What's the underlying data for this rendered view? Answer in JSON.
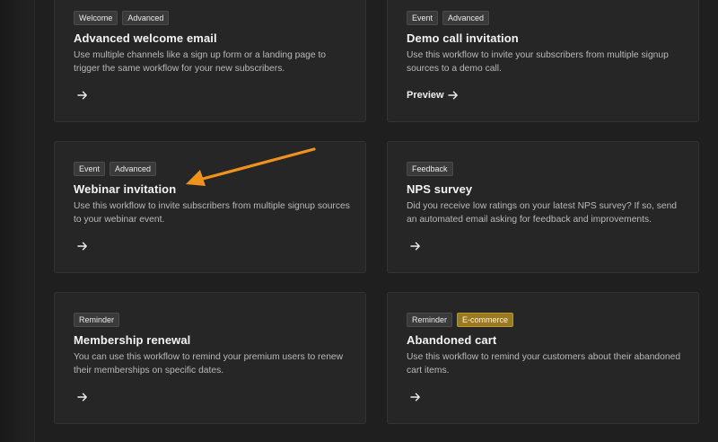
{
  "cards": [
    {
      "tags": [
        {
          "label": "Welcome"
        },
        {
          "label": "Advanced"
        }
      ],
      "title": "Advanced welcome email",
      "description": "Use multiple channels like a sign up form or a landing page to trigger the same workflow for your new subscribers.",
      "action_label": ""
    },
    {
      "tags": [
        {
          "label": "Event"
        },
        {
          "label": "Advanced"
        }
      ],
      "title": "Demo call invitation",
      "description": "Use this workflow to invite your subscribers from multiple signup sources to a demo call.",
      "action_label": "Preview"
    },
    {
      "tags": [
        {
          "label": "Event"
        },
        {
          "label": "Advanced"
        }
      ],
      "title": "Webinar invitation",
      "description": "Use this workflow to invite subscribers from multiple signup sources to your webinar event.",
      "action_label": ""
    },
    {
      "tags": [
        {
          "label": "Feedback"
        }
      ],
      "title": "NPS survey",
      "description": "Did you receive low ratings on your latest NPS survey? If so, send an automated email asking for feedback and improvements.",
      "action_label": ""
    },
    {
      "tags": [
        {
          "label": "Reminder"
        }
      ],
      "title": "Membership renewal",
      "description": "You can use this workflow to remind your premium users to renew their memberships on specific dates.",
      "action_label": ""
    },
    {
      "tags": [
        {
          "label": "Reminder"
        },
        {
          "label": "E-commerce",
          "accent": "#9a7a21"
        }
      ],
      "title": "Abandoned cart",
      "description": "Use this workflow to remind your customers about their abandoned cart items.",
      "action_label": ""
    }
  ],
  "annotation": {
    "color": "#f0921c",
    "icon": "arrow-pointer-icon"
  }
}
